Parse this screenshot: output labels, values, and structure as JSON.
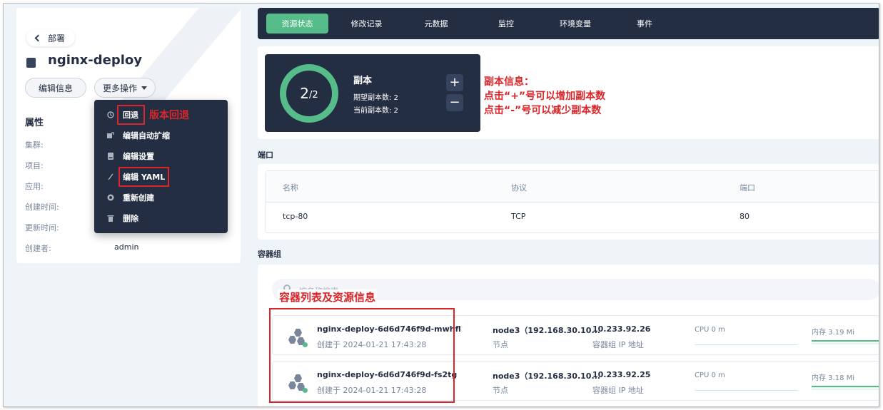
{
  "left": {
    "back_label": "部署",
    "title": "nginx-deploy",
    "edit_info_btn": "编辑信息",
    "more_ops_btn": "更多操作",
    "attr_title": "属性",
    "attrs": [
      {
        "label": "集群:",
        "value": ""
      },
      {
        "label": "项目:",
        "value": ""
      },
      {
        "label": "应用:",
        "value": ""
      },
      {
        "label": "创建时间:",
        "value": ""
      },
      {
        "label": "更新时间:",
        "value": ""
      },
      {
        "label": "创建者:",
        "value": "admin"
      }
    ]
  },
  "menu": {
    "items": [
      {
        "label": "回退",
        "icon": "history-icon"
      },
      {
        "label": "编辑自动扩缩",
        "icon": "autoscale-icon"
      },
      {
        "label": "编辑设置",
        "icon": "settings-icon"
      },
      {
        "label": "编辑 YAML",
        "icon": "edit-icon"
      },
      {
        "label": "重新创建",
        "icon": "recreate-icon"
      },
      {
        "label": "删除",
        "icon": "trash-icon"
      }
    ]
  },
  "annotations": {
    "rollback": "版本回退",
    "replica_title": "副本信息：",
    "replica_plus": "点击“+”号可以增加副本数",
    "replica_minus": "点击“-”号可以减少副本数",
    "containers": "容器列表及资源信息"
  },
  "tabs": [
    "资源状态",
    "修改记录",
    "元数据",
    "监控",
    "环境变量",
    "事件"
  ],
  "replicas": {
    "current": "2",
    "desired": "/2",
    "title": "副本",
    "desired_line": "期望副本数: 2",
    "current_line": "当前副本数: 2",
    "plus": "+",
    "minus": "−"
  },
  "ports": {
    "section": "端口",
    "headers": [
      "名称",
      "协议",
      "端口"
    ],
    "row": [
      "tcp-80",
      "TCP",
      "80"
    ]
  },
  "pods": {
    "section": "容器组",
    "search_placeholder": "按名称搜索",
    "rows": [
      {
        "name": "nginx-deploy-6d6d746f9d-mwhfl",
        "created": "创建于 2024-01-21 17:43:28",
        "node": "node3（192.168.30.10...",
        "node_label": "节点",
        "ip": "10.233.92.26",
        "ip_label": "容器组 IP 地址",
        "cpu": "CPU 0 m",
        "mem": "内存 3.19 Mi"
      },
      {
        "name": "nginx-deploy-6d6d746f9d-fs2tg",
        "created": "创建于 2024-01-21 17:43:28",
        "node": "node3（192.168.30.10...",
        "node_label": "节点",
        "ip": "10.233.92.25",
        "ip_label": "容器组 IP 地址",
        "cpu": "CPU 0 m",
        "mem": "内存 3.18 Mi"
      }
    ]
  },
  "colors": {
    "accent": "#55bc8a",
    "dark": "#242e42",
    "annotation": "#d9262a"
  }
}
